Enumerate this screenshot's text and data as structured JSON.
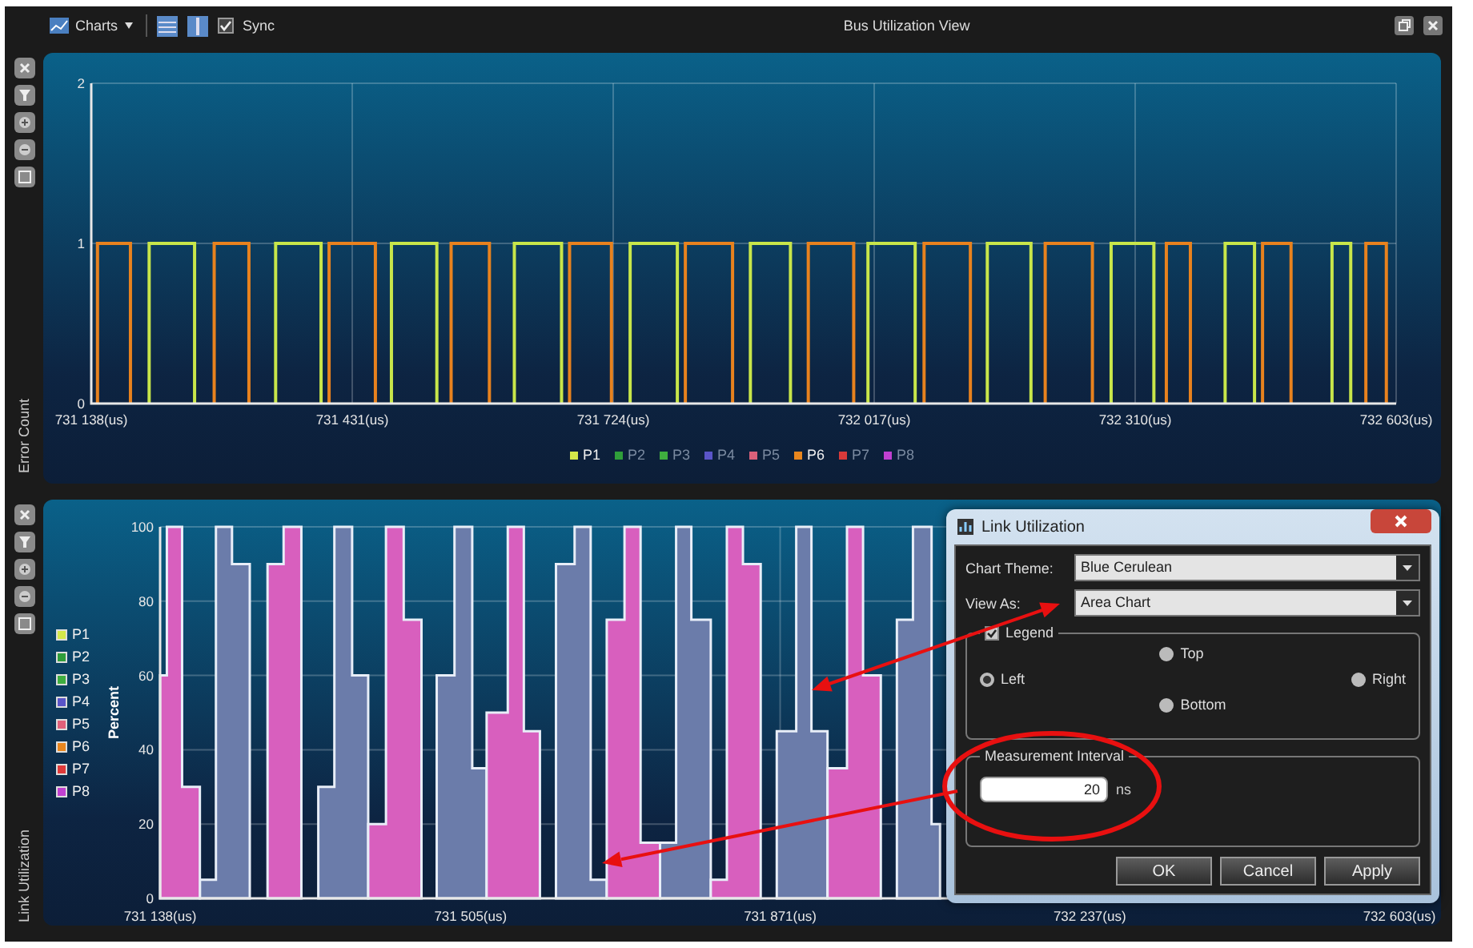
{
  "toolbar": {
    "charts_menu": "Charts",
    "sync": {
      "label": "Sync",
      "checked": true
    },
    "title": "Bus Utilization View"
  },
  "error_count_pane": {
    "side_label": "Error Count",
    "chart_data": {
      "type": "line",
      "grid": true,
      "x": [
        731145,
        731145,
        731182,
        731182,
        731203,
        731203,
        731254,
        731254,
        731276,
        731276,
        731315,
        731315,
        731345,
        731345,
        731396,
        731396,
        731405,
        731405,
        731457,
        731457,
        731475,
        731475,
        731526,
        731526,
        731542,
        731542,
        731585,
        731585,
        731613,
        731613,
        731666,
        731666,
        731675,
        731675,
        731722,
        731722,
        731743,
        731743,
        731796,
        731796,
        731805,
        731805,
        731858,
        731858,
        731878,
        731878,
        731923,
        731923,
        731943,
        731943,
        731994,
        731994,
        732010,
        732010,
        732063,
        732063,
        732073,
        732073,
        732125,
        732125,
        732144,
        732144,
        732193,
        732193,
        732209,
        732209,
        732262,
        732262,
        732283,
        732283,
        732331,
        732331,
        732345,
        732345,
        732372,
        732372,
        732411,
        732411,
        732444,
        732444,
        732453,
        732453,
        732485,
        732485,
        732531,
        732531,
        732552,
        732552,
        732569,
        732569,
        732592,
        732592
      ],
      "series": [
        {
          "color": "#c8e64a",
          "values": [
            null,
            null,
            null,
            null,
            0,
            1,
            1,
            0,
            null,
            null,
            null,
            null,
            0,
            1,
            1,
            0,
            null,
            null,
            null,
            null,
            0,
            1,
            1,
            0,
            null,
            null,
            null,
            null,
            0,
            1,
            1,
            0,
            null,
            null,
            null,
            null,
            0,
            1,
            1,
            0,
            null,
            null,
            null,
            null,
            0,
            1,
            1,
            0,
            null,
            null,
            null,
            null,
            0,
            1,
            1,
            0,
            null,
            null,
            null,
            null,
            0,
            1,
            1,
            0,
            null,
            null,
            null,
            null,
            0,
            1,
            1,
            0,
            null,
            null,
            null,
            null,
            0,
            1,
            1,
            0,
            null,
            null,
            null,
            null,
            0,
            1,
            1,
            0,
            null,
            null,
            null,
            null
          ]
        },
        {
          "color": "#e8821e",
          "values": [
            0,
            1,
            1,
            0,
            null,
            null,
            null,
            null,
            0,
            1,
            1,
            0,
            null,
            null,
            null,
            null,
            0,
            1,
            1,
            0,
            null,
            null,
            null,
            null,
            0,
            1,
            1,
            0,
            null,
            null,
            null,
            null,
            0,
            1,
            1,
            0,
            null,
            null,
            null,
            null,
            0,
            1,
            1,
            0,
            null,
            null,
            null,
            null,
            0,
            1,
            1,
            0,
            null,
            null,
            null,
            null,
            0,
            1,
            1,
            0,
            null,
            null,
            null,
            null,
            0,
            1,
            1,
            0,
            null,
            null,
            null,
            null,
            0,
            1,
            1,
            0,
            null,
            null,
            null,
            null,
            0,
            1,
            1,
            0,
            null,
            null,
            null,
            null,
            0,
            1,
            1,
            0
          ]
        }
      ],
      "xlim": [
        731138,
        732603
      ],
      "ylim": [
        0,
        2
      ],
      "yticks": [
        0,
        1,
        2
      ],
      "xticks": [
        {
          "value": 731138,
          "label": "731 138(us)"
        },
        {
          "value": 731431,
          "label": "731 431(us)"
        },
        {
          "value": 731724,
          "label": "731 724(us)"
        },
        {
          "value": 732017,
          "label": "732 017(us)"
        },
        {
          "value": 732310,
          "label": "732 310(us)"
        },
        {
          "value": 732603,
          "label": "732 603(us)"
        }
      ]
    },
    "legend": [
      {
        "label": "P1",
        "color": "#d4e84a",
        "active": true
      },
      {
        "label": "P2",
        "color": "#2f9e3a",
        "active": false
      },
      {
        "label": "P3",
        "color": "#3fae3f",
        "active": false
      },
      {
        "label": "P4",
        "color": "#5a55c8",
        "active": false
      },
      {
        "label": "P5",
        "color": "#d8607a",
        "active": false
      },
      {
        "label": "P6",
        "color": "#e8861e",
        "active": true
      },
      {
        "label": "P7",
        "color": "#d83a3a",
        "active": false
      },
      {
        "label": "P8",
        "color": "#c040d0",
        "active": false
      }
    ]
  },
  "link_utilization_pane": {
    "side_label": "Link Utilization",
    "legend": [
      {
        "label": "P1",
        "color": "#d4e84a"
      },
      {
        "label": "P2",
        "color": "#2f9e3a"
      },
      {
        "label": "P3",
        "color": "#3fae3f"
      },
      {
        "label": "P4",
        "color": "#5a55c8"
      },
      {
        "label": "P5",
        "color": "#e0607a"
      },
      {
        "label": "P6",
        "color": "#e8861e"
      },
      {
        "label": "P7",
        "color": "#e03a3a"
      },
      {
        "label": "P8",
        "color": "#c040d0"
      }
    ],
    "chart_data": {
      "type": "area",
      "grid": true,
      "ylabel": "Percent",
      "x": [
        731138,
        731146,
        731164,
        731185,
        731204,
        731223,
        731244,
        731265,
        731284,
        731305,
        731325,
        731344,
        731365,
        731384,
        731405,
        731426,
        731447,
        731465,
        731486,
        731507,
        731524,
        731549,
        731568,
        731587,
        731606,
        731628,
        731647,
        731666,
        731687,
        731706,
        731729,
        731748,
        731766,
        731789,
        731808,
        731827,
        731848,
        731867,
        731890,
        731908,
        731927,
        731950,
        731969,
        731990,
        732009,
        732028,
        732050,
        732060
      ],
      "series": [
        {
          "color": "#6b7caa",
          "values": [
            null,
            null,
            null,
            5,
            100,
            90,
            null,
            null,
            null,
            null,
            30,
            100,
            60,
            null,
            null,
            null,
            null,
            60,
            100,
            35,
            null,
            null,
            null,
            null,
            90,
            100,
            5,
            null,
            null,
            null,
            15,
            100,
            75,
            null,
            null,
            null,
            null,
            45,
            100,
            45,
            null,
            null,
            null,
            null,
            75,
            100,
            20,
            20
          ]
        },
        {
          "color": "#d85fbe",
          "values": [
            60,
            100,
            30,
            null,
            null,
            null,
            null,
            90,
            100,
            null,
            null,
            null,
            null,
            20,
            100,
            75,
            null,
            null,
            null,
            null,
            50,
            100,
            45,
            null,
            null,
            null,
            null,
            75,
            100,
            15,
            null,
            null,
            null,
            5,
            100,
            90,
            null,
            null,
            null,
            null,
            35,
            100,
            60,
            0,
            null,
            null,
            null,
            null
          ]
        }
      ],
      "xlim": [
        731138,
        732603
      ],
      "ylim": [
        0,
        100
      ],
      "yticks": [
        0,
        20,
        40,
        60,
        80,
        100
      ],
      "xticks": [
        {
          "value": 731138,
          "label": "731 138(us)"
        },
        {
          "value": 731505,
          "label": "731 505(us)"
        },
        {
          "value": 731871,
          "label": "731 871(us)"
        },
        {
          "value": 732237,
          "label": "732 237(us)"
        },
        {
          "value": 732603,
          "label": "732 603(us)"
        }
      ]
    }
  },
  "dialog": {
    "title": "Link Utilization",
    "fields": [
      {
        "label": "Chart Theme:",
        "value": "Blue Cerulean"
      },
      {
        "label": "View As:",
        "value": "Area Chart"
      }
    ],
    "legend_group": {
      "label": "Legend",
      "checked": true,
      "positions": [
        {
          "label": "Top",
          "selected": false
        },
        {
          "label": "Left",
          "selected": true
        },
        {
          "label": "Right",
          "selected": false
        },
        {
          "label": "Bottom",
          "selected": false
        }
      ]
    },
    "interval_group": {
      "label": "Measurement Interval",
      "value": "20",
      "unit": "ns"
    },
    "buttons": [
      "OK",
      "Cancel",
      "Apply"
    ]
  }
}
